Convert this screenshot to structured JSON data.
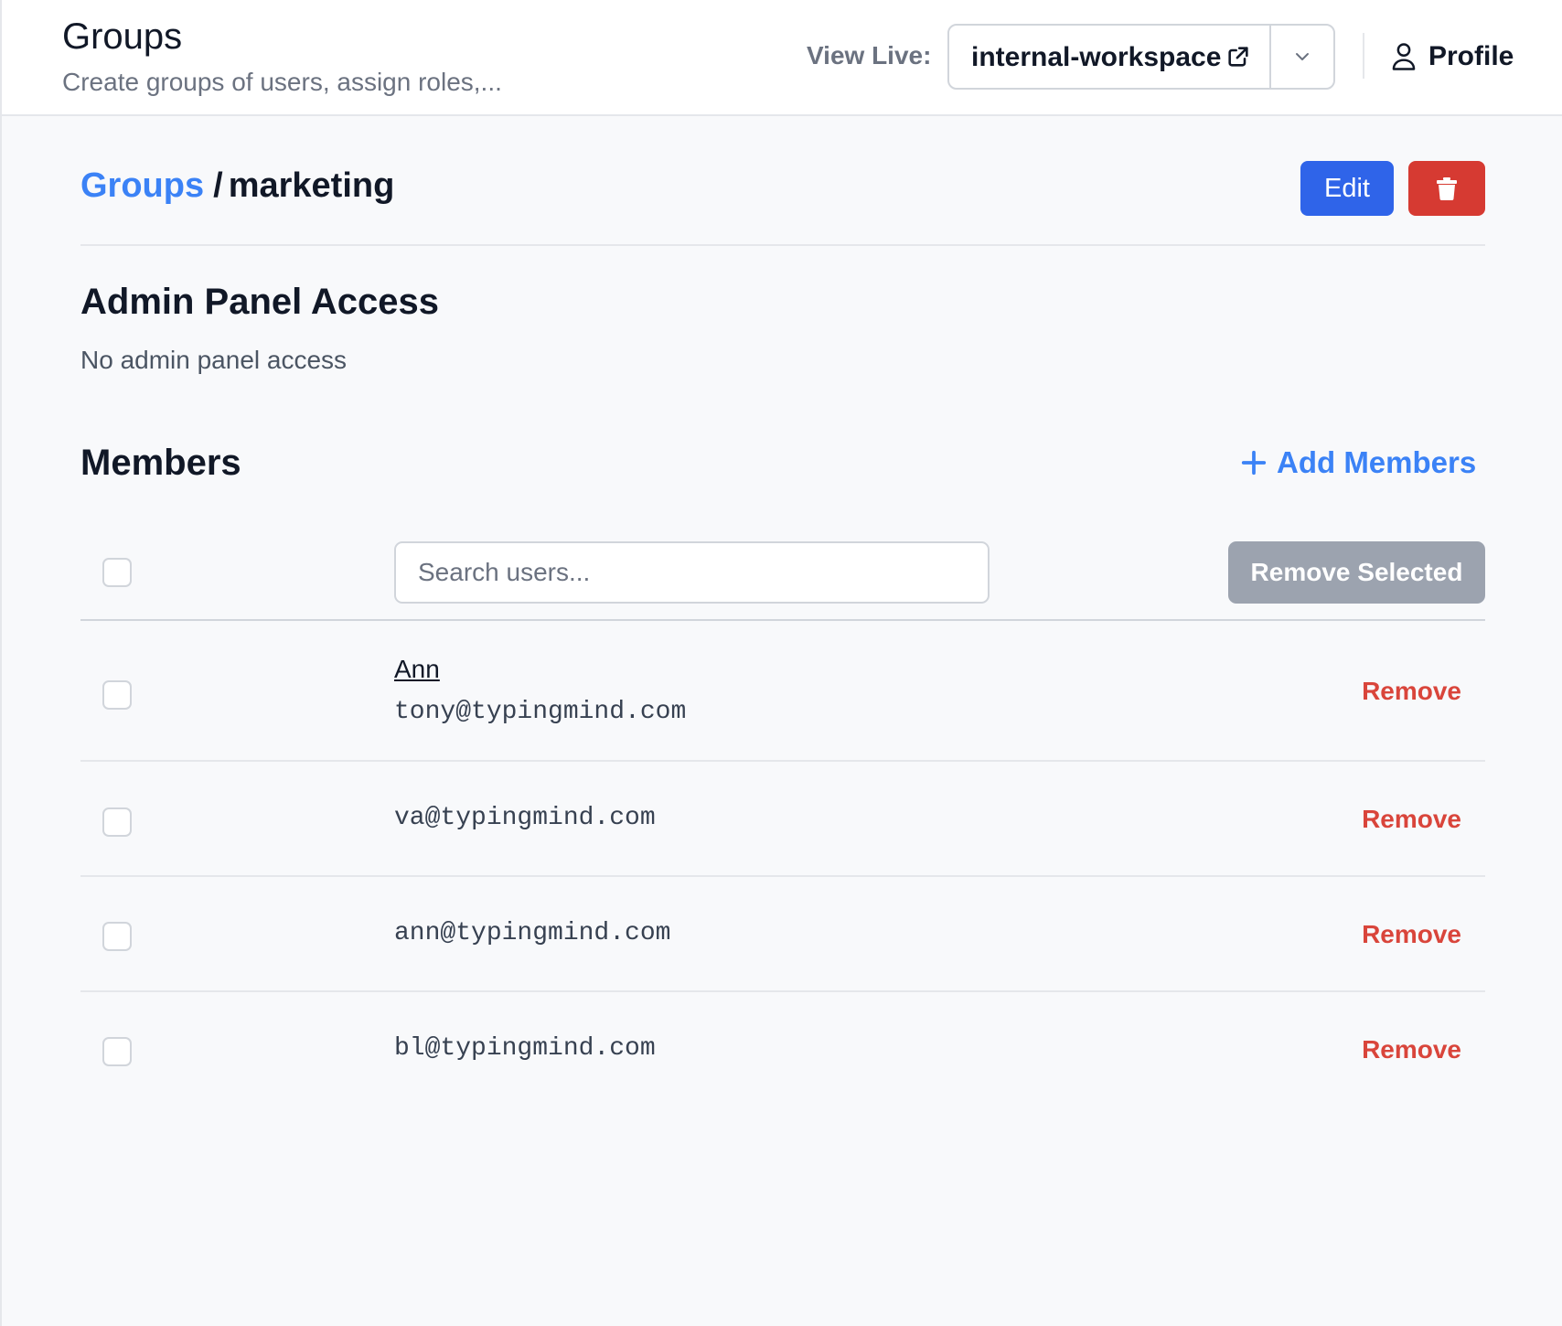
{
  "header": {
    "title": "Groups",
    "subtitle": "Create groups of users, assign roles,...",
    "view_live_label": "View Live:",
    "workspace": "internal-workspace",
    "profile_label": "Profile"
  },
  "breadcrumb": {
    "parent": "Groups",
    "separator": "/",
    "current": "marketing"
  },
  "actions": {
    "edit_label": "Edit",
    "delete_icon": "trash-icon"
  },
  "admin_panel": {
    "title": "Admin Panel Access",
    "text": "No admin panel access"
  },
  "members": {
    "title": "Members",
    "add_label": "Add Members",
    "search_placeholder": "Search users...",
    "remove_selected_label": "Remove Selected",
    "remove_label": "Remove",
    "rows": [
      {
        "name": "Ann",
        "email": "tony@typingmind.com"
      },
      {
        "name": "",
        "email": "va@typingmind.com"
      },
      {
        "name": "",
        "email": "ann@typingmind.com"
      },
      {
        "name": "",
        "email": "bl@typingmind.com"
      }
    ]
  },
  "colors": {
    "primary": "#2f64e9",
    "link": "#3b82f6",
    "danger": "#d63a32",
    "remove_text": "#d9453b",
    "disabled": "#9ca3af"
  }
}
